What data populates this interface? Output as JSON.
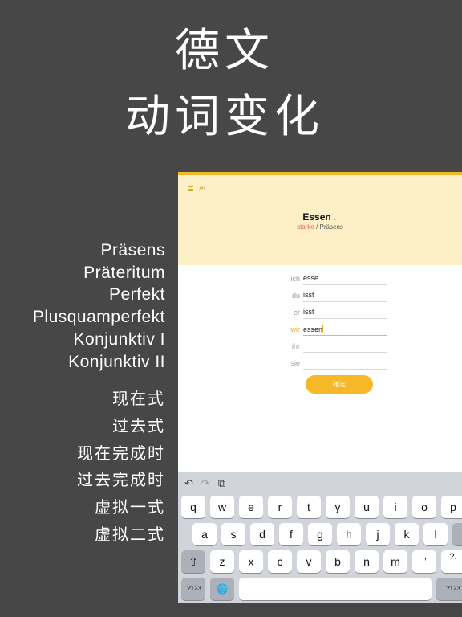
{
  "hero": {
    "line1": "德文",
    "line2": "动词变化"
  },
  "tenses_de": [
    "Präsens",
    "Präteritum",
    "Perfekt",
    "Plusquamperfekt",
    "Konjunktiv I",
    "Konjunktiv II"
  ],
  "tenses_zh": [
    "现在式",
    "过去式",
    "现在完成时",
    "过去完成时",
    "虚拟一式",
    "虚拟二式"
  ],
  "app": {
    "progress": "1/6",
    "verb": "Essen",
    "verb_type": "starke",
    "separator": " / ",
    "tense": "Präsens",
    "rows": [
      {
        "pronoun": "ich",
        "answer": "esse"
      },
      {
        "pronoun": "du",
        "answer": "isst"
      },
      {
        "pronoun": "er",
        "answer": "isst"
      },
      {
        "pronoun": "wir",
        "answer": "essen"
      },
      {
        "pronoun": "ihr",
        "answer": ""
      },
      {
        "pronoun": "sie",
        "answer": ""
      }
    ],
    "confirm_label": "確定"
  },
  "keyboard": {
    "tools": [
      "↶",
      "↷",
      "⧉"
    ],
    "row1": [
      "q",
      "w",
      "e",
      "r",
      "t",
      "y",
      "u",
      "i",
      "o",
      "p"
    ],
    "row2": [
      "a",
      "s",
      "d",
      "f",
      "g",
      "h",
      "j",
      "k",
      "l"
    ],
    "row3": [
      "z",
      "x",
      "c",
      "v",
      "b",
      "n",
      "m",
      "!,",
      "?."
    ],
    "numbers_label": ".?123",
    "globe": "🌐",
    "shift": "⇧"
  },
  "colors": {
    "background": "#474747",
    "accent": "#f6b828",
    "header": "#fdefc6",
    "strong": "#e95a5a"
  }
}
